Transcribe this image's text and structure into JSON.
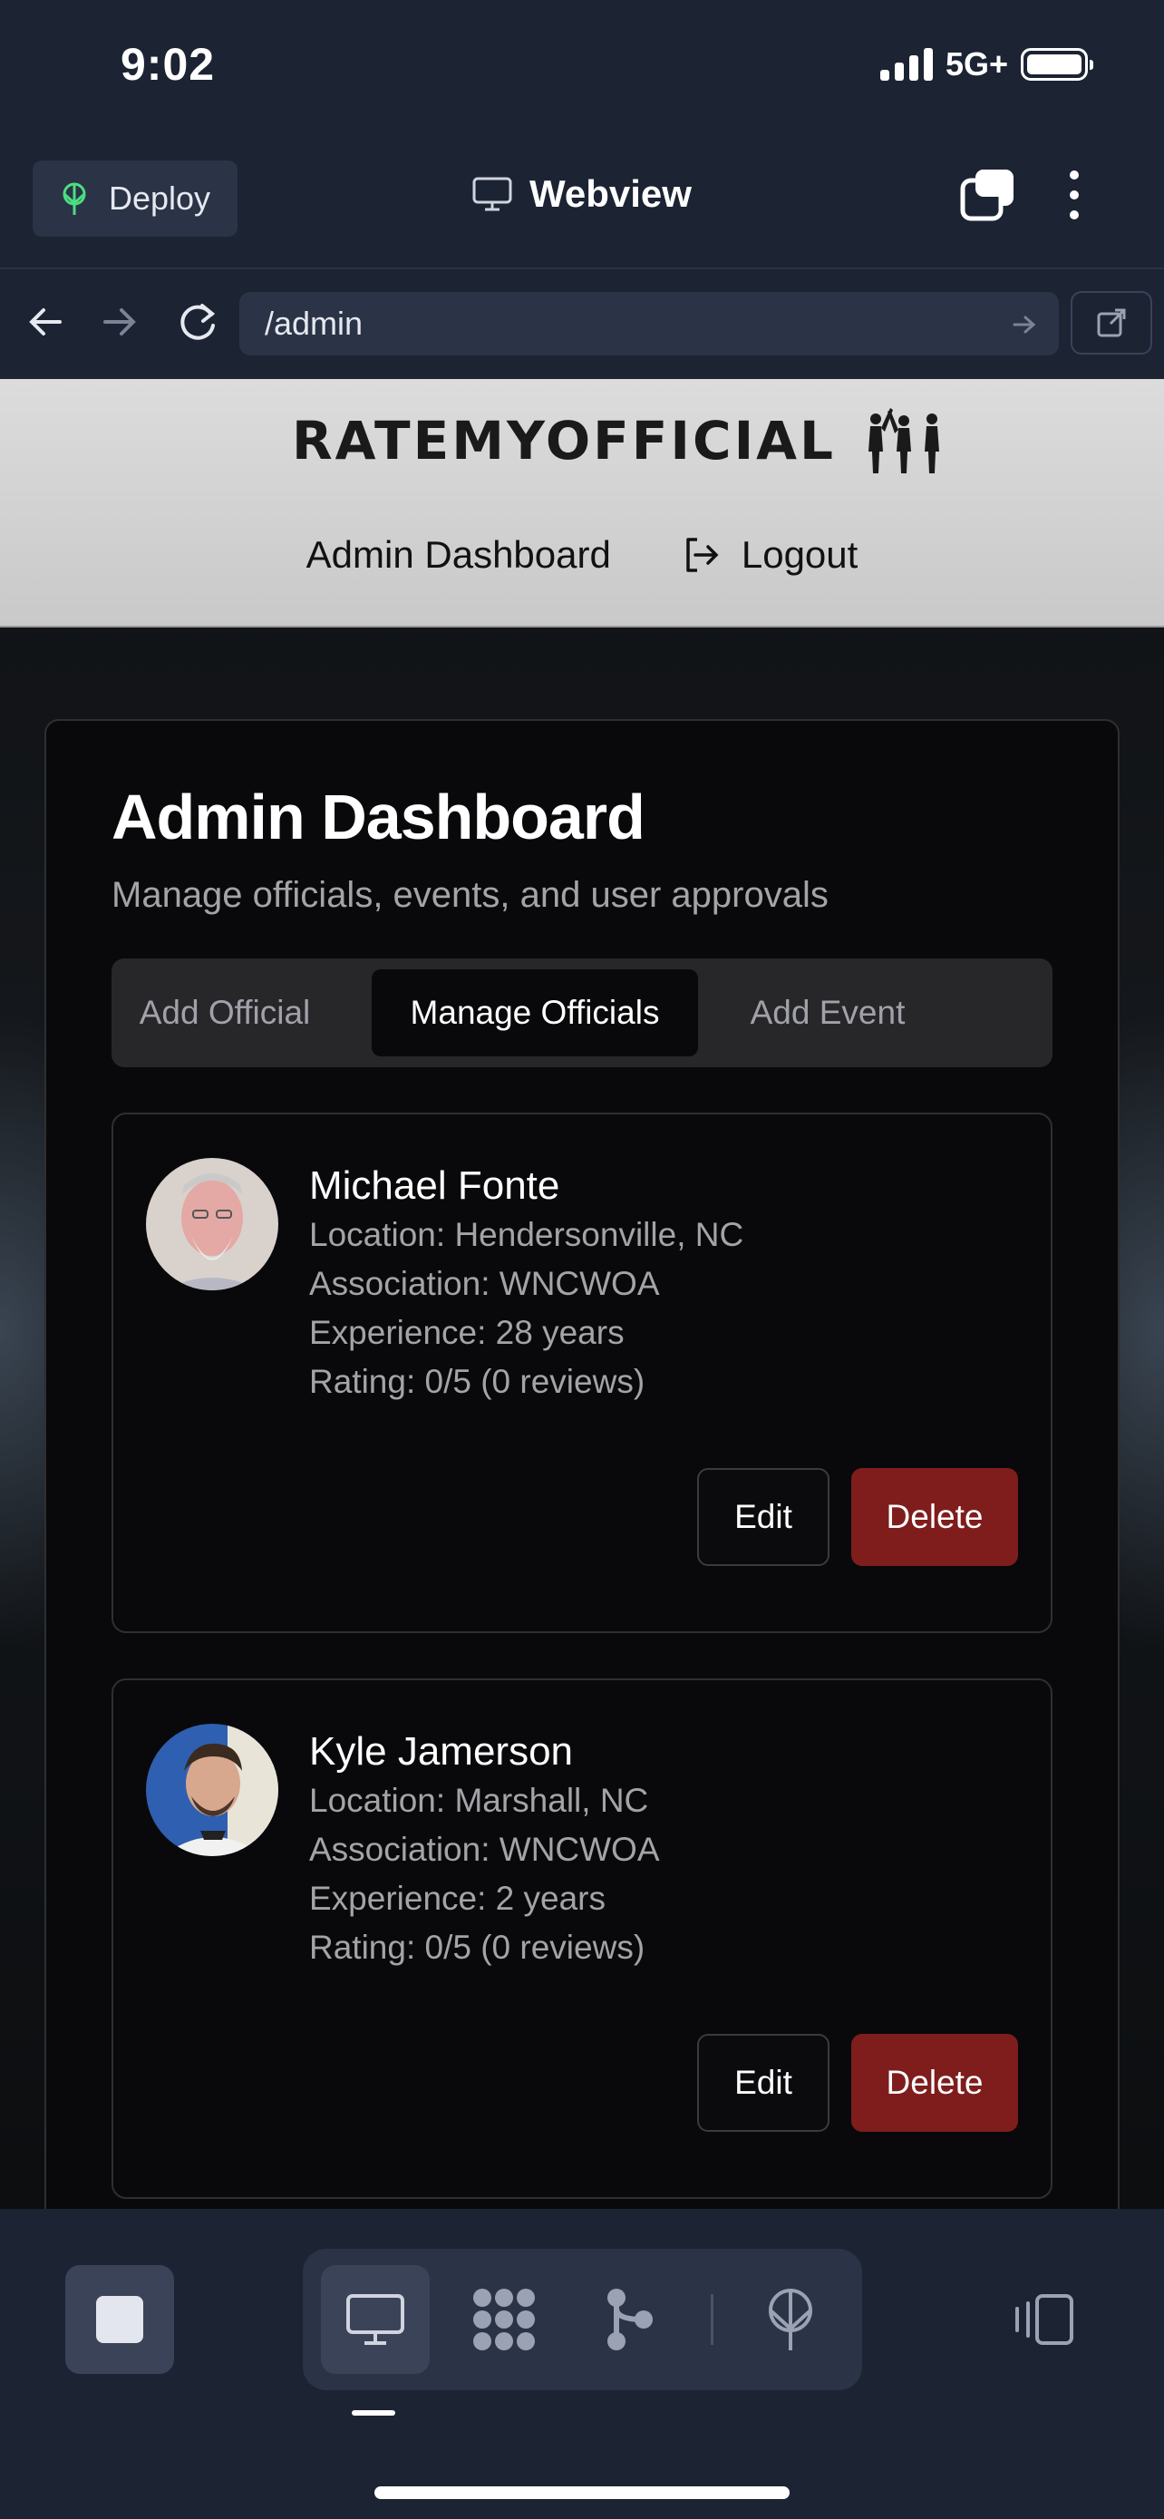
{
  "status_bar": {
    "time": "9:02",
    "network": "5G+"
  },
  "app_header": {
    "deploy_label": "Deploy",
    "title": "Webview"
  },
  "url_bar": {
    "url": "/admin"
  },
  "site": {
    "logo_text": "RATEMYOFFICIAL",
    "nav": {
      "dashboard": "Admin Dashboard",
      "logout": "Logout"
    }
  },
  "dashboard": {
    "title": "Admin Dashboard",
    "subtitle": "Manage officials, events, and user approvals",
    "tabs": [
      {
        "label": "Add Official",
        "active": false
      },
      {
        "label": "Manage Officials",
        "active": true
      },
      {
        "label": "Add Event",
        "active": false
      }
    ]
  },
  "officials": [
    {
      "name": "Michael Fonte",
      "location": "Location: Hendersonville, NC",
      "association": "Association: WNCWOA",
      "experience": "Experience: 28 years",
      "rating": "Rating: 0/5 (0 reviews)"
    },
    {
      "name": "Kyle Jamerson",
      "location": "Location: Marshall, NC",
      "association": "Association: WNCWOA",
      "experience": "Experience: 2 years",
      "rating": "Rating: 0/5 (0 reviews)"
    }
  ],
  "actions": {
    "edit": "Edit",
    "delete": "Delete"
  },
  "colors": {
    "accent_delete": "#7f1d1d",
    "app_bg": "#1c2333",
    "deploy_icon": "#4ade80"
  }
}
